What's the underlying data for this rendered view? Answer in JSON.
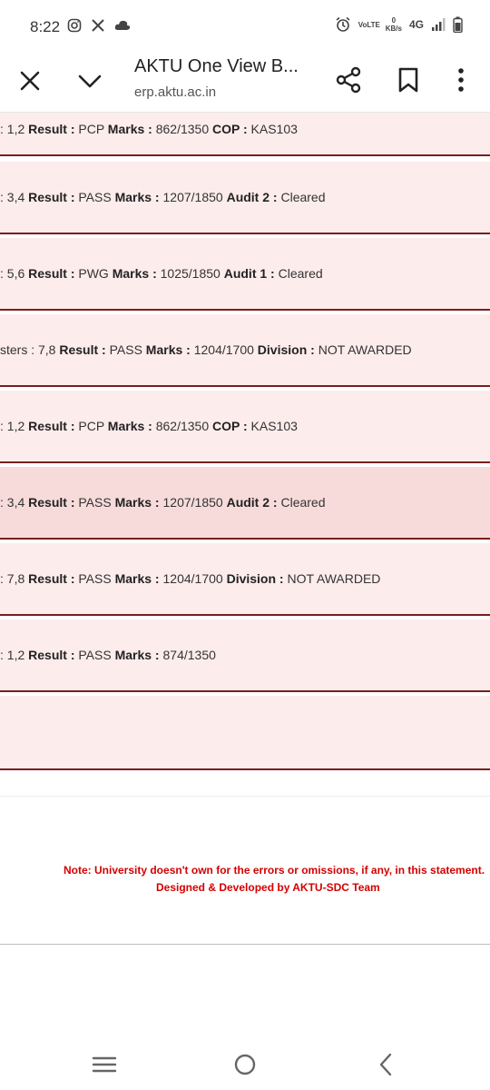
{
  "status": {
    "time": "8:22",
    "volte": "VoLTE",
    "kbs_value": "0",
    "kbs_unit": "KB/s",
    "network": "4G"
  },
  "tab": {
    "title": "AKTU One View B...",
    "url": "erp.aktu.ac.in"
  },
  "rows": [
    {
      "prefix": ": 1,2 ",
      "l1": "Result :",
      "v1": " PCP ",
      "l2": "Marks :",
      "v2": " 862/1350 ",
      "l3": "COP :",
      "v3": " KAS103"
    },
    {
      "prefix": ": 3,4 ",
      "l1": "Result :",
      "v1": " PASS ",
      "l2": "Marks :",
      "v2": " 1207/1850 ",
      "l3": "Audit 2 :",
      "v3": " Cleared"
    },
    {
      "prefix": ": 5,6 ",
      "l1": "Result :",
      "v1": " PWG ",
      "l2": "Marks :",
      "v2": " 1025/1850 ",
      "l3": "Audit 1 :",
      "v3": " Cleared"
    },
    {
      "prefix": "sters : 7,8 ",
      "l1": "Result :",
      "v1": " PASS ",
      "l2": "Marks :",
      "v2": " 1204/1700 ",
      "l3": "Division :",
      "v3": " NOT AWARDED"
    },
    {
      "prefix": ": 1,2 ",
      "l1": "Result :",
      "v1": " PCP ",
      "l2": "Marks :",
      "v2": " 862/1350 ",
      "l3": "COP :",
      "v3": " KAS103"
    },
    {
      "prefix": ": 3,4 ",
      "l1": "Result :",
      "v1": " PASS ",
      "l2": "Marks :",
      "v2": " 1207/1850 ",
      "l3": "Audit 2 :",
      "v3": " Cleared"
    },
    {
      "prefix": ": 7,8 ",
      "l1": "Result :",
      "v1": " PASS ",
      "l2": "Marks :",
      "v2": " 1204/1700 ",
      "l3": "Division :",
      "v3": " NOT AWARDED"
    },
    {
      "prefix": ": 1,2 ",
      "l1": "Result :",
      "v1": " PASS ",
      "l2": "Marks :",
      "v2": " 874/1350",
      "l3": "",
      "v3": ""
    }
  ],
  "footer": {
    "note": "Note: University doesn't own for the errors or omissions, if any, in this statement.",
    "credit": "Designed & Developed by AKTU-SDC Team"
  },
  "colors": {
    "row_bg": "#fdecec",
    "row_selected_bg": "#f7dbdb",
    "border": "#7a1e1e",
    "note_red": "#d40000"
  }
}
